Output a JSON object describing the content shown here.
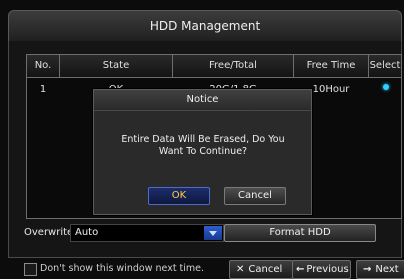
{
  "window": {
    "title": "HDD Management"
  },
  "table": {
    "columns": [
      "No.",
      "State",
      "Free/Total",
      "Free Time",
      "Select"
    ],
    "rows": [
      {
        "no": "1",
        "state": "OK",
        "free_total": "20G/1.8G",
        "free_time": "10Hour"
      }
    ]
  },
  "dialog": {
    "title": "Notice",
    "message": "Entire Data Will Be Erased, Do You Want To Continue?",
    "ok_label": "OK",
    "cancel_label": "Cancel"
  },
  "overwrite": {
    "label": "Overwrite",
    "value": "Auto"
  },
  "format_button": {
    "label": "Format HDD"
  },
  "footer": {
    "checkbox_label": "Don't show this window next time.",
    "cancel_label": "Cancel",
    "previous_label": "Previous",
    "next_label": "Next"
  },
  "icons": {
    "cancel": "x-icon",
    "previous": "arrow-left-icon",
    "next": "arrow-right-icon",
    "dropdown": "chevron-down-icon"
  },
  "colors": {
    "accent_blue": "#2c5fd0",
    "select_dot": "#2fd0ff",
    "ok_text": "#ffd23a"
  }
}
